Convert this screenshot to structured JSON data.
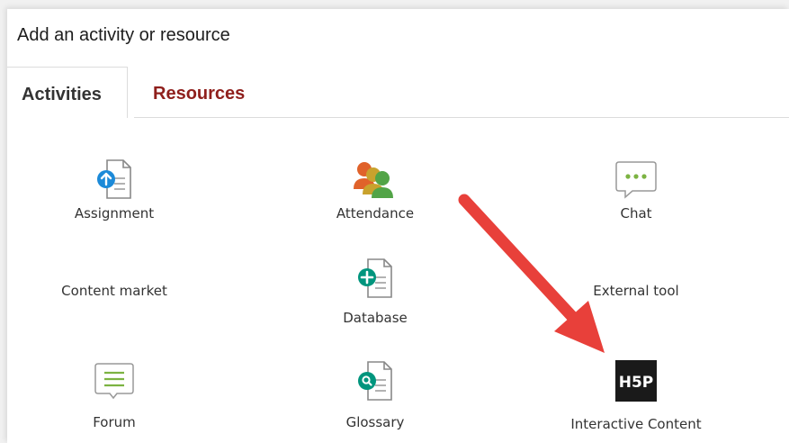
{
  "dialog": {
    "title": "Add an activity or resource"
  },
  "tabs": [
    {
      "label": "Activities",
      "active": true
    },
    {
      "label": "Resources",
      "active": false
    }
  ],
  "items": {
    "assignment": {
      "label": "Assignment",
      "icon": "assignment-icon"
    },
    "attendance": {
      "label": "Attendance",
      "icon": "attendance-icon"
    },
    "chat": {
      "label": "Chat",
      "icon": "chat-icon"
    },
    "content_market": {
      "label": "Content market",
      "icon": null
    },
    "database": {
      "label": "Database",
      "icon": "database-icon"
    },
    "external_tool": {
      "label": "External tool",
      "icon": null
    },
    "forum": {
      "label": "Forum",
      "icon": "forum-icon"
    },
    "glossary": {
      "label": "Glossary",
      "icon": "glossary-icon"
    },
    "interactive_content": {
      "label": "Interactive Content",
      "icon": "h5p-icon",
      "icon_text": "H5P"
    }
  },
  "colors": {
    "resources_tab": "#8f1f1c",
    "annotation_arrow": "#e8403a",
    "assignment_badge": "#1c8ad8",
    "database_badge": "#00957d",
    "glossary_badge": "#00957d",
    "chat_outline": "#7cb342"
  }
}
